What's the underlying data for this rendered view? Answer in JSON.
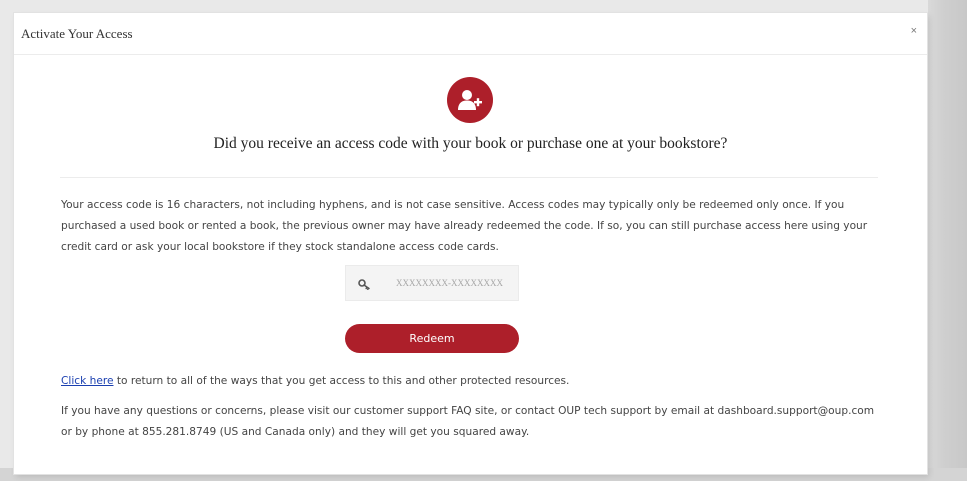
{
  "dialog": {
    "title": "Activate Your Access",
    "close_label": "×"
  },
  "header": {
    "icon": "add-user-icon",
    "question": "Did you receive an access code with your book or purchase one at your bookstore?"
  },
  "info": {
    "text": "Your access code is 16 characters, not including hyphens, and is not case sensitive. Access codes may typically only be redeemed only once. If you purchased a used book or rented a book, the previous owner may have already redeemed the code. If so, you can still purchase access here using your credit card or ask your local bookstore if they stock standalone access code cards."
  },
  "code_field": {
    "icon": "key-icon",
    "placeholder": "XXXXXXXX-XXXXXXXX",
    "value": ""
  },
  "redeem": {
    "label": "Redeem"
  },
  "return_line": {
    "link_text": "Click here",
    "rest": " to return to all of the ways that you get access to this and other protected resources."
  },
  "support": {
    "text": "If you have any questions or concerns, please visit our customer support FAQ site, or contact OUP tech support by email at dashboard.support@oup.com or by phone at 855.281.8749 (US and Canada only) and they will get you squared away."
  },
  "colors": {
    "accent": "#ad1f2a",
    "link": "#1a3fb0"
  }
}
